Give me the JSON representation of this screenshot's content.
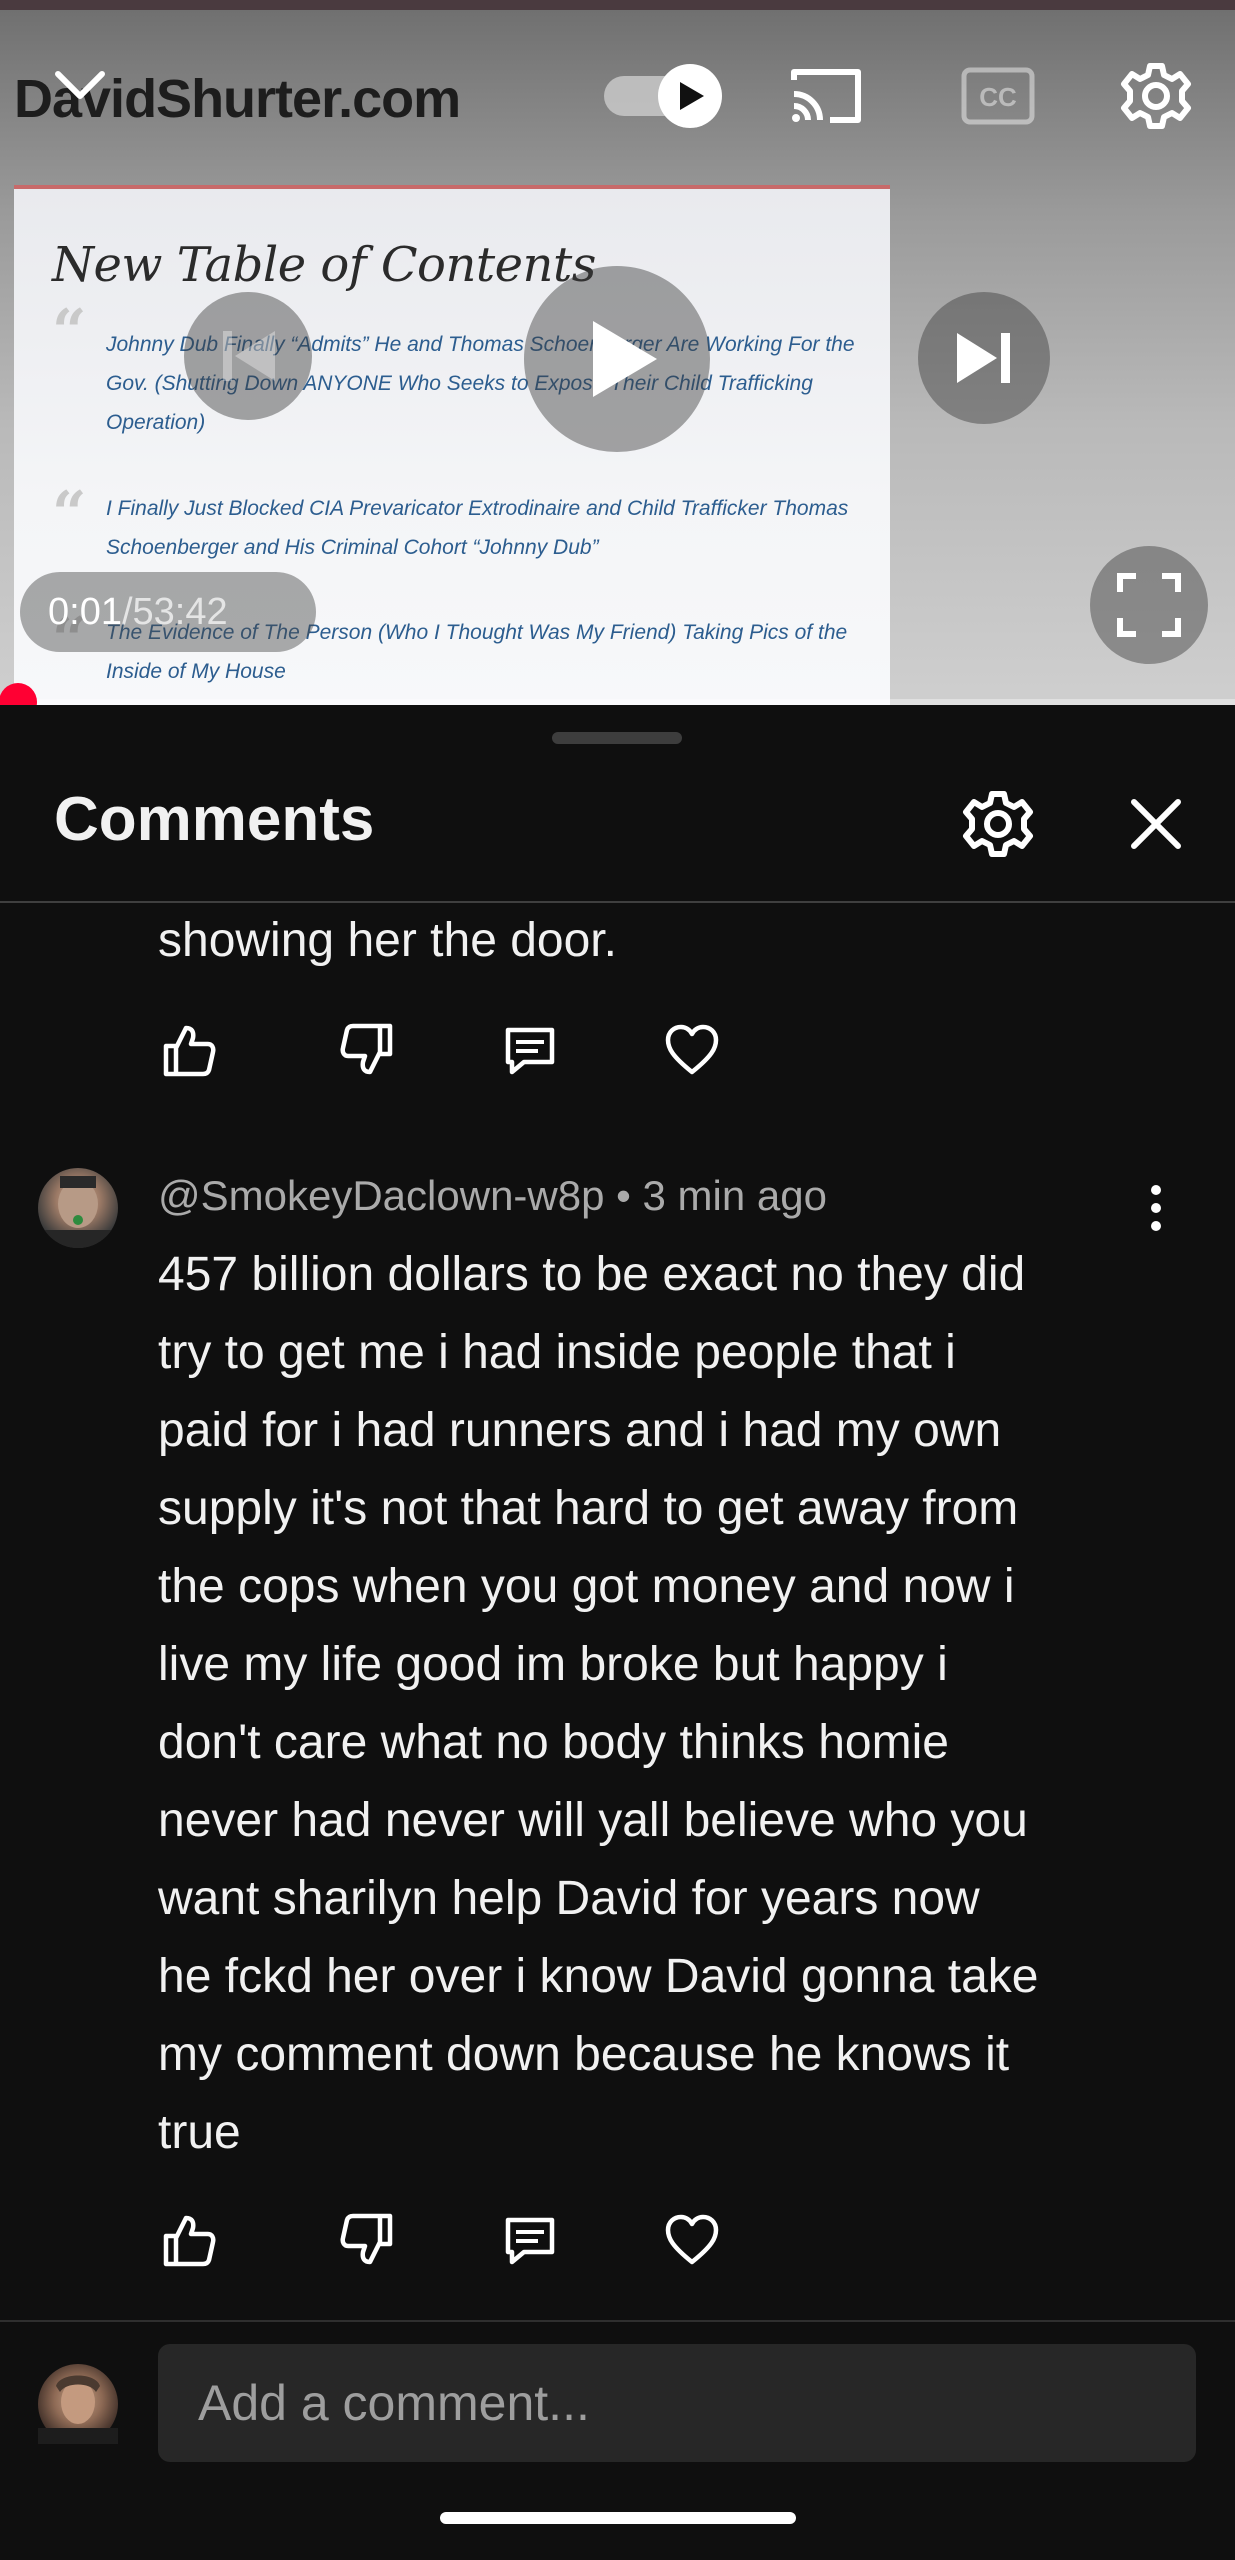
{
  "player": {
    "site_title": "DavidShurter.com",
    "slide_title": "New Table of Contents",
    "toc_items": [
      "Johnny Dub Finally “Admits” He and Thomas Schoenberger Are Working For the Gov. (Shutting Down ANYONE Who Seeks to Expose Their Child Trafficking Operation)",
      "I Finally Just Blocked CIA Prevaricator Extrodinaire and Child Trafficker Thomas Schoenberger and His Criminal Cohort “Johnny Dub”",
      "The Evidence of The Person (Who I Thought Was My Friend) Taking Pics of the Inside of My House"
    ],
    "time_current": "0:01",
    "time_separator": " / ",
    "time_total": "53:42",
    "progress_fraction": 0.0003,
    "icons": {
      "collapse": "chevron-down-icon",
      "autoplay": "autoplay-toggle-icon",
      "cast": "cast-icon",
      "captions": "cc-icon",
      "settings": "gear-icon",
      "previous": "skip-previous-icon",
      "play": "play-icon",
      "next": "skip-next-icon",
      "fullscreen": "fullscreen-icon"
    },
    "accent_color": "#ff0033"
  },
  "comments_panel": {
    "title": "Comments",
    "previous_comment_tail": "showing her the door.",
    "comment": {
      "author": "@SmokeyDaclown-w8p",
      "separator": " • ",
      "time_ago": "3 min ago",
      "lines": [
        "457 billion dollars to be exact no they did",
        "try to get me i had inside people that i",
        "paid for i had runners and i had my own",
        "supply it's not that hard to get away from",
        "the cops when you got money and now i",
        "live my life good im broke but happy i",
        "don't care what no body thinks homie",
        "never had never will yall believe who you",
        "want sharilyn help David for years now",
        "he fckd her over i know David gonna take",
        "my comment down because he knows it",
        "true"
      ]
    },
    "input_placeholder": "Add a comment..."
  }
}
